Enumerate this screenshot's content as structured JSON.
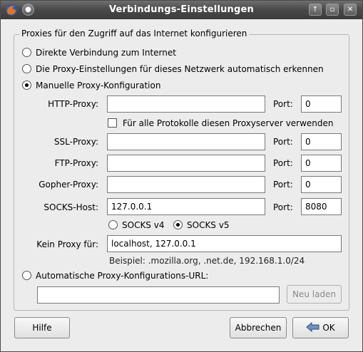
{
  "window": {
    "title": "Verbindungs-Einstellungen"
  },
  "group": {
    "legend": "Proxies für den Zugriff auf das Internet konfigurieren"
  },
  "options": {
    "direct": "Direkte Verbindung zum Internet",
    "auto_detect": "Die Proxy-Einstellungen für dieses Netzwerk automatisch erkennen",
    "manual": "Manuelle Proxy-Konfiguration",
    "auto_url": "Automatische Proxy-Konfigurations-URL:",
    "selected": "manual"
  },
  "manual": {
    "http_label": "HTTP-Proxy:",
    "http_value": "",
    "http_port_label": "Port:",
    "http_port": "0",
    "same_proxy_label": "Für alle Protokolle diesen Proxyserver verwenden",
    "same_proxy_checked": false,
    "ssl_label": "SSL-Proxy:",
    "ssl_value": "",
    "ssl_port_label": "Port:",
    "ssl_port": "0",
    "ftp_label": "FTP-Proxy:",
    "ftp_value": "",
    "ftp_port_label": "Port:",
    "ftp_port": "0",
    "gopher_label": "Gopher-Proxy:",
    "gopher_value": "",
    "gopher_port_label": "Port:",
    "gopher_port": "0",
    "socks_label": "SOCKS-Host:",
    "socks_value": "127.0.0.1",
    "socks_port_label": "Port:",
    "socks_port": "8080",
    "socks_v4": "SOCKS v4",
    "socks_v5": "SOCKS v5",
    "socks_selected": "v5",
    "no_proxy_label": "Kein Proxy für:",
    "no_proxy_value": "localhost, 127.0.0.1",
    "example": "Beispiel: .mozilla.org, .net.de, 192.168.1.0/24"
  },
  "auto_url": {
    "value": "",
    "reload_label": "Neu laden"
  },
  "buttons": {
    "help": "Hilfe",
    "cancel": "Abbrechen",
    "ok": "OK"
  },
  "colors": {
    "titlebar": "#4a4a4a",
    "background": "#ececec"
  },
  "icons": {
    "app": "firefox-icon",
    "menu": "window-menu-icon",
    "ok": "back-arrow-icon"
  }
}
